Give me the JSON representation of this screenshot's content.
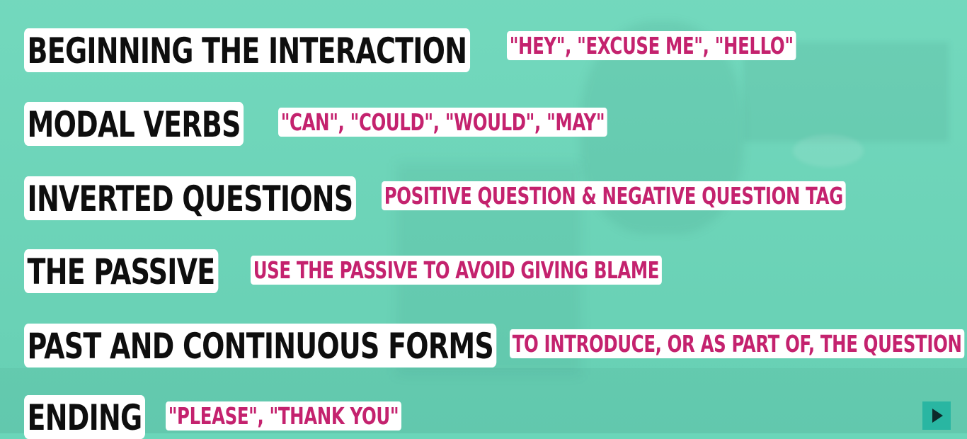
{
  "rows": [
    {
      "title": "BEGINNING THE INTERACTION",
      "note": "\"HEY\", \"EXCUSE ME\", \"HELLO\""
    },
    {
      "title": "MODAL VERBS",
      "note": "\"CAN\", \"COULD\", \"WOULD\", \"MAY\""
    },
    {
      "title": "INVERTED QUESTIONS",
      "note": "POSITIVE QUESTION & NEGATIVE QUESTION TAG"
    },
    {
      "title": "THE PASSIVE",
      "note": "USE THE PASSIVE TO AVOID GIVING BLAME"
    },
    {
      "title": "PAST AND CONTINUOUS FORMS",
      "note": "TO INTRODUCE, OR AS PART OF, THE QUESTION"
    },
    {
      "title": "ENDING",
      "note": "\"PLEASE\", \"THANK YOU\""
    }
  ],
  "colors": {
    "background": "#6ad6b9",
    "title_text": "#0e0e0e",
    "note_text": "#c4226e",
    "label_bg": "#ffffff",
    "play_button": "#29b6a2"
  },
  "icons": {
    "play": "play-icon"
  }
}
